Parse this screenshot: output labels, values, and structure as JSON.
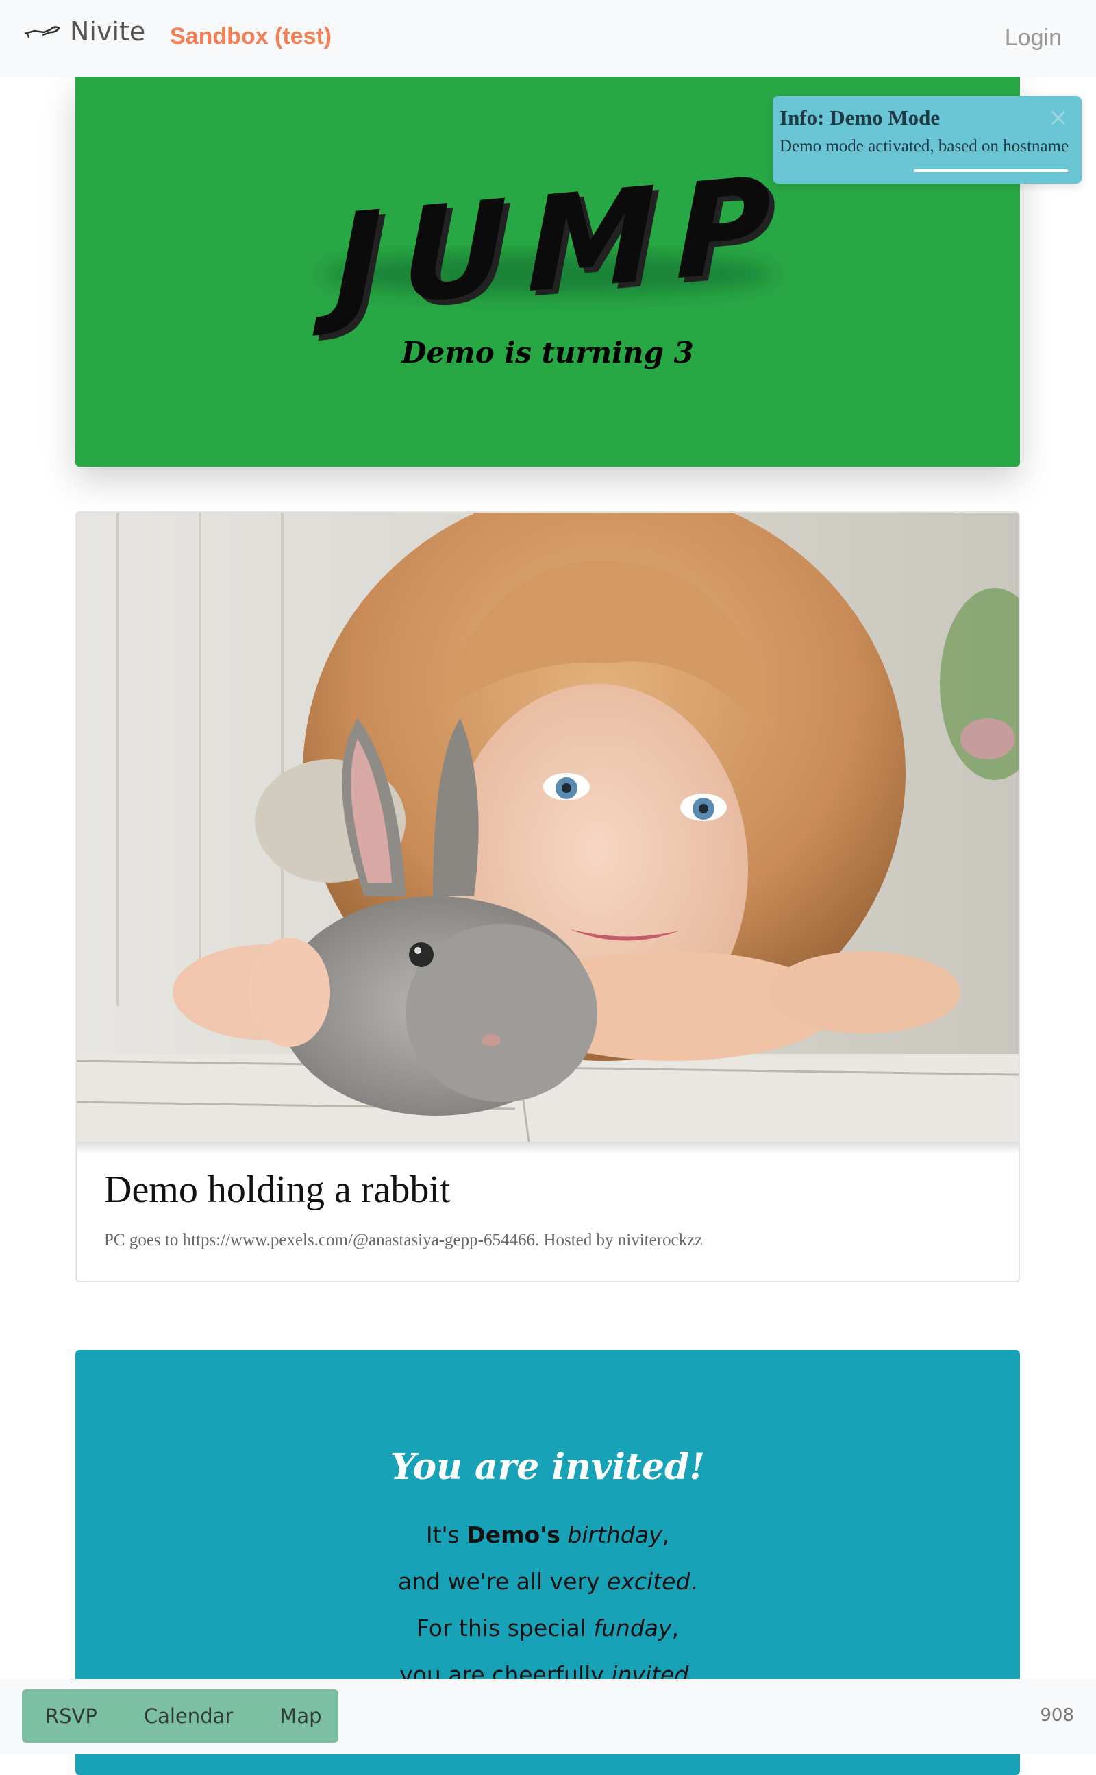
{
  "navbar": {
    "brand": "Nivite",
    "env_label": "Sandbox (test)",
    "login": "Login"
  },
  "hero": {
    "word": "JUMP",
    "subtitle": "Demo is turning 3",
    "background": "#28a745"
  },
  "toast": {
    "title": "Info: Demo Mode",
    "body": "Demo mode activated, based on hostname",
    "background": "#69c4d4"
  },
  "photo_card": {
    "title": "Demo holding a rabbit",
    "caption": "PC goes to https://www.pexels.com/@anastasiya-gepp-654466. Hosted by niviterockzz"
  },
  "invite": {
    "title": "You are invited!",
    "line1_pre": "It's ",
    "line1_bold": "Demo's",
    "line1_em": "birthday",
    "line1_post": ",",
    "line2_pre": "and we're all very ",
    "line2_em": "excited",
    "line2_post": ".",
    "line3_pre": "For this special ",
    "line3_em": "funday",
    "line3_post": ",",
    "line4_pre": "you are cheerfully ",
    "line4_em": "invited",
    "line4_post": ".",
    "background": "#17a2b8"
  },
  "bottombar": {
    "buttons": [
      "RSVP",
      "Calendar",
      "Map"
    ],
    "count": "908"
  },
  "icons": {
    "brand": "bird-logo-icon",
    "close": "close-icon"
  }
}
